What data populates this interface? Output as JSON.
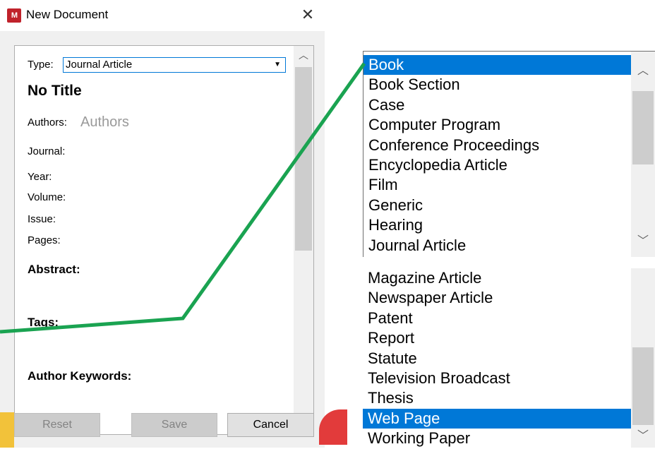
{
  "dialog": {
    "title": "New Document",
    "logo_text": "M",
    "close_glyph": "✕",
    "type_label": "Type:",
    "type_value": "Journal Article",
    "doc_title": "No Title",
    "authors_label": "Authors:",
    "authors_placeholder": "Authors",
    "journal_label": "Journal:",
    "year_label": "Year:",
    "volume_label": "Volume:",
    "issue_label": "Issue:",
    "pages_label": "Pages:",
    "abstract_heading": "Abstract:",
    "tags_heading": "Tags:",
    "keywords_heading": "Author Keywords:",
    "buttons": {
      "reset": "Reset",
      "save": "Save",
      "cancel": "Cancel"
    }
  },
  "type_list_top": {
    "items": [
      "Book",
      "Book Section",
      "Case",
      "Computer Program",
      "Conference Proceedings",
      "Encyclopedia Article",
      "Film",
      "Generic",
      "Hearing",
      "Journal Article"
    ],
    "selected": "Book"
  },
  "type_list_bottom": {
    "items": [
      "Magazine Article",
      "Newspaper Article",
      "Patent",
      "Report",
      "Statute",
      "Television Broadcast",
      "Thesis",
      "Web Page",
      "Working Paper"
    ],
    "selected": "Web Page"
  },
  "colors": {
    "selection": "#0078d7",
    "connector": "#1aa351",
    "logo": "#c0222b"
  },
  "icons": {
    "scroll_up": "chevron-up-icon",
    "scroll_down": "chevron-down-icon",
    "dropdown": "caret-down-icon"
  }
}
